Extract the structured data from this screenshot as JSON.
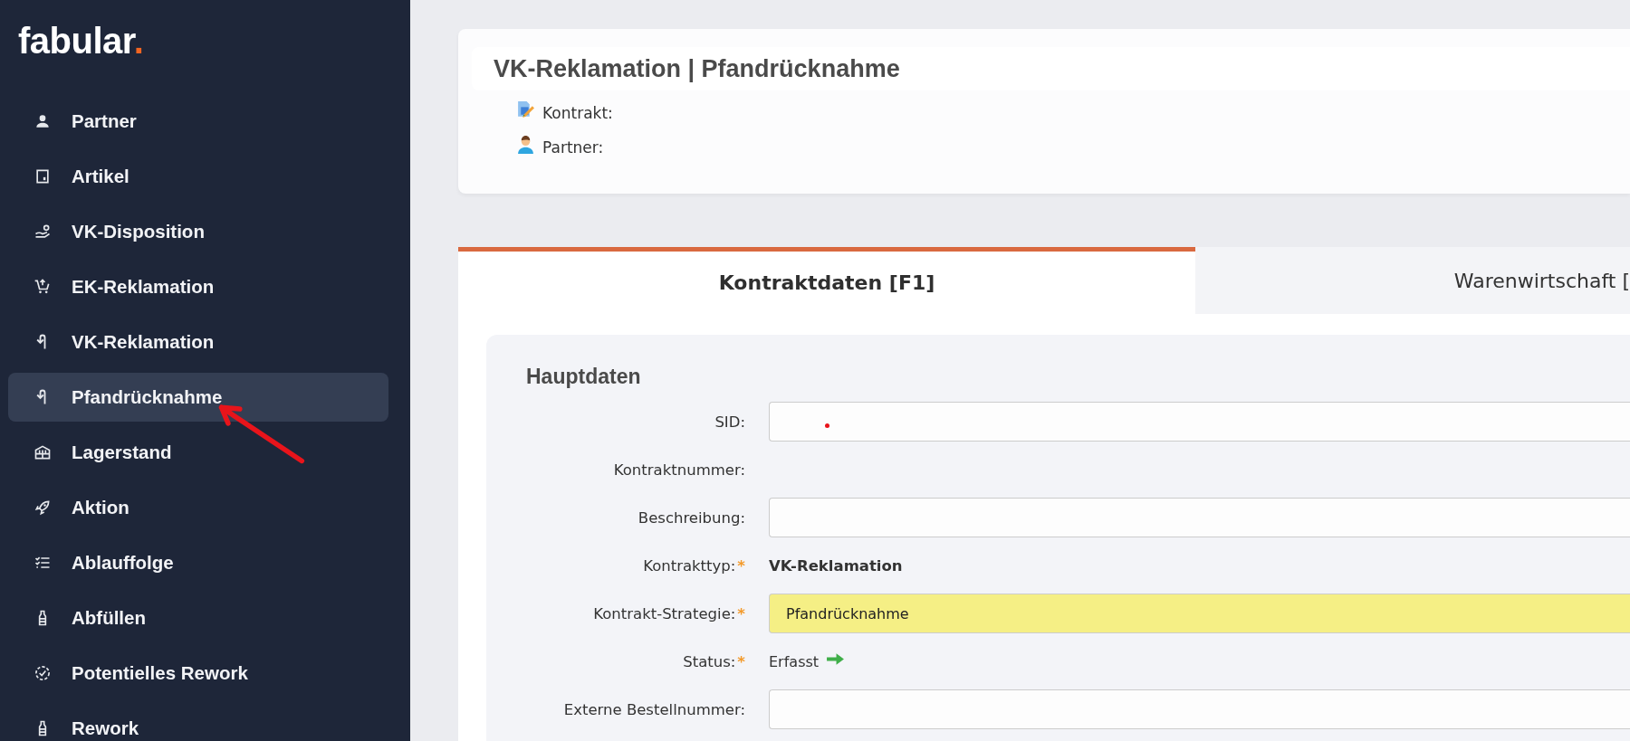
{
  "logo": {
    "text": "fabular",
    "dot": "."
  },
  "sidebar": {
    "items": [
      {
        "label": "Partner",
        "selected": false
      },
      {
        "label": "Artikel",
        "selected": false
      },
      {
        "label": "VK-Disposition",
        "selected": false
      },
      {
        "label": "EK-Reklamation",
        "selected": false
      },
      {
        "label": "VK-Reklamation",
        "selected": false
      },
      {
        "label": "Pfandrücknahme",
        "selected": true
      },
      {
        "label": "Lagerstand",
        "selected": false
      },
      {
        "label": "Aktion",
        "selected": false
      },
      {
        "label": "Ablauffolge",
        "selected": false
      },
      {
        "label": "Abfüllen",
        "selected": false
      },
      {
        "label": "Potentielles Rework",
        "selected": false
      },
      {
        "label": "Rework",
        "selected": false
      }
    ]
  },
  "header": {
    "title": "VK-Reklamation | Pfandrücknahme",
    "details": [
      {
        "kind": "contract",
        "label": "Kontrakt:"
      },
      {
        "kind": "partner",
        "label": "Partner:"
      }
    ]
  },
  "tabs": [
    {
      "label": "Kontraktdaten [F1]",
      "selected": true
    },
    {
      "label": "Warenwirtschaft [",
      "selected": false
    }
  ],
  "section": {
    "title": "Hauptdaten",
    "required_mark": "*",
    "fields": [
      {
        "kind": "input",
        "label": "SID:",
        "required": false
      },
      {
        "kind": "text",
        "label": "Kontraktnummer:",
        "required": false
      },
      {
        "kind": "input",
        "label": "Beschreibung:",
        "required": false
      },
      {
        "kind": "bold",
        "label": "Kontrakttyp:",
        "required": true,
        "value": "VK-Reklamation"
      },
      {
        "kind": "highlight",
        "label": "Kontrakt-Strategie:",
        "required": true,
        "value": "Pfandrücknahme"
      },
      {
        "kind": "status",
        "label": "Status:",
        "required": true,
        "value": "Erfasst"
      },
      {
        "kind": "input",
        "label": "Externe Bestellnummer:",
        "required": false
      }
    ]
  }
}
